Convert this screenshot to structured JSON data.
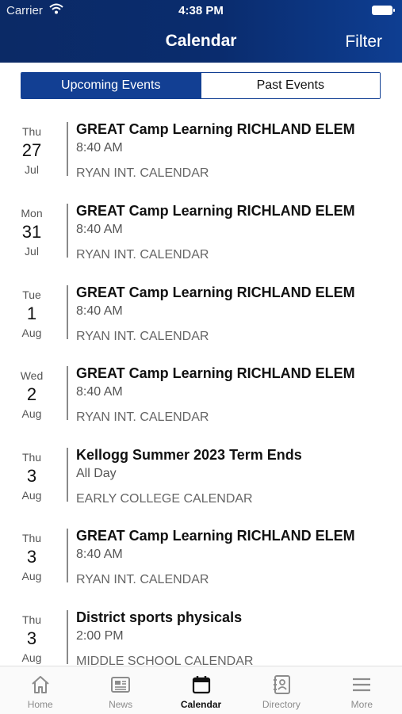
{
  "status": {
    "carrier": "Carrier",
    "time": "4:38 PM"
  },
  "header": {
    "title": "Calendar",
    "filter_label": "Filter"
  },
  "segments": {
    "upcoming": "Upcoming Events",
    "past": "Past Events",
    "selected": "upcoming"
  },
  "events": [
    {
      "dow": "Thu",
      "day": "27",
      "month": "Jul",
      "title": "GREAT Camp Learning RICHLAND ELEM",
      "time": "8:40 AM",
      "calendar": "RYAN INT. CALENDAR"
    },
    {
      "dow": "Mon",
      "day": "31",
      "month": "Jul",
      "title": "GREAT Camp Learning RICHLAND ELEM",
      "time": "8:40 AM",
      "calendar": "RYAN INT. CALENDAR"
    },
    {
      "dow": "Tue",
      "day": "1",
      "month": "Aug",
      "title": "GREAT Camp Learning RICHLAND ELEM",
      "time": "8:40 AM",
      "calendar": "RYAN INT. CALENDAR"
    },
    {
      "dow": "Wed",
      "day": "2",
      "month": "Aug",
      "title": "GREAT Camp Learning RICHLAND ELEM",
      "time": "8:40 AM",
      "calendar": "RYAN INT. CALENDAR"
    },
    {
      "dow": "Thu",
      "day": "3",
      "month": "Aug",
      "title": "Kellogg Summer 2023 Term Ends",
      "time": "All Day",
      "calendar": "EARLY COLLEGE CALENDAR"
    },
    {
      "dow": "Thu",
      "day": "3",
      "month": "Aug",
      "title": "GREAT Camp Learning RICHLAND ELEM",
      "time": "8:40 AM",
      "calendar": "RYAN INT. CALENDAR"
    },
    {
      "dow": "Thu",
      "day": "3",
      "month": "Aug",
      "title": "District sports physicals",
      "time": "2:00 PM",
      "calendar": "MIDDLE SCHOOL CALENDAR"
    }
  ],
  "tabs": [
    {
      "label": "Home",
      "icon": "home-icon"
    },
    {
      "label": "News",
      "icon": "news-icon"
    },
    {
      "label": "Calendar",
      "icon": "calendar-icon",
      "active": true
    },
    {
      "label": "Directory",
      "icon": "directory-icon"
    },
    {
      "label": "More",
      "icon": "menu-icon"
    }
  ],
  "colors": {
    "header": "#0b2a66",
    "accent": "#123f93"
  }
}
